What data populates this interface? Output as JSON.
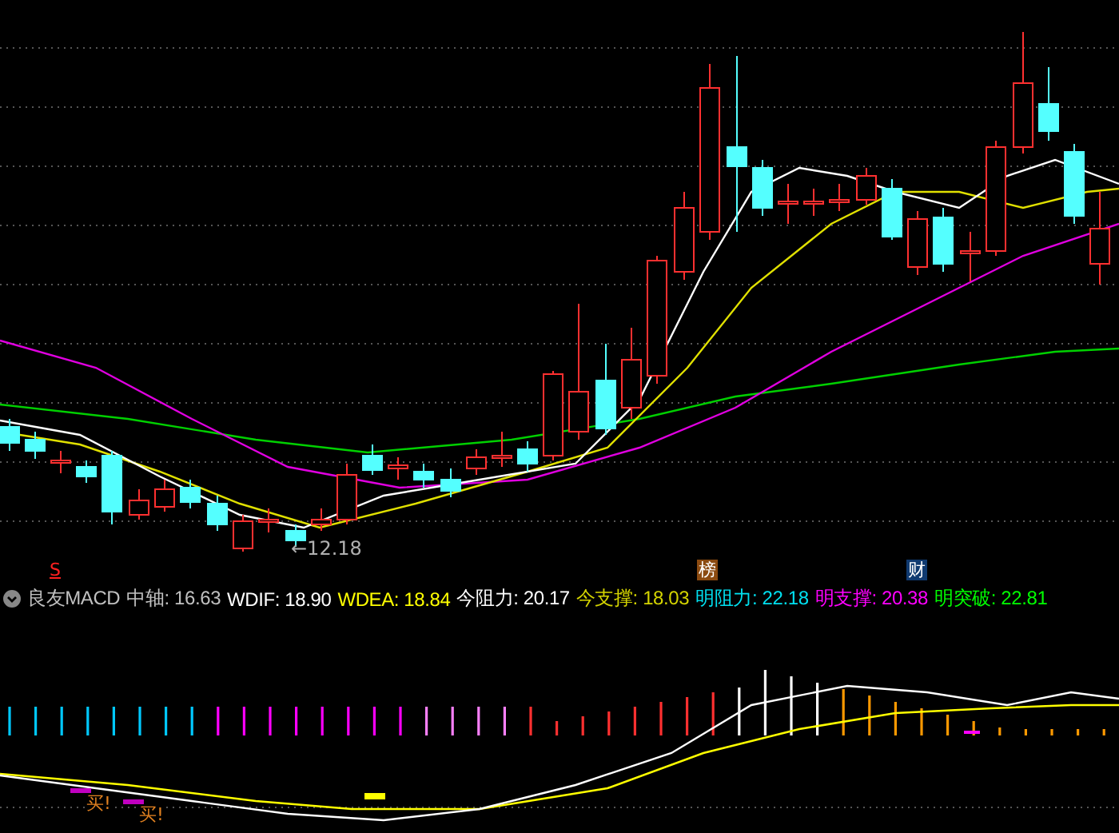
{
  "price_chart": {
    "low_label": "←12.18",
    "markers": [
      {
        "text": "S",
        "kind": "sell"
      },
      {
        "text": "榜",
        "kind": "list"
      },
      {
        "text": "财",
        "kind": "finance"
      }
    ]
  },
  "indicator": {
    "name": "良友MACD",
    "stats": [
      {
        "label": "中轴:",
        "value": "16.63",
        "color": "#c0c0c0"
      },
      {
        "label": "WDIF:",
        "value": "18.90",
        "color": "#ffffff"
      },
      {
        "label": "WDEA:",
        "value": "18.84",
        "color": "#ffff00"
      },
      {
        "label": "今阻力:",
        "value": "20.17",
        "color": "#ffffff"
      },
      {
        "label": "今支撑:",
        "value": "18.03",
        "color": "#d4d400"
      },
      {
        "label": "明阻力:",
        "value": "22.18",
        "color": "#00e0f0"
      },
      {
        "label": "明支撑:",
        "value": "20.38",
        "color": "#ff00ff"
      },
      {
        "label": "明突破:",
        "value": "22.81",
        "color": "#00ff00"
      }
    ]
  },
  "macd": {
    "signals": [
      "买!",
      "买!"
    ]
  }
}
